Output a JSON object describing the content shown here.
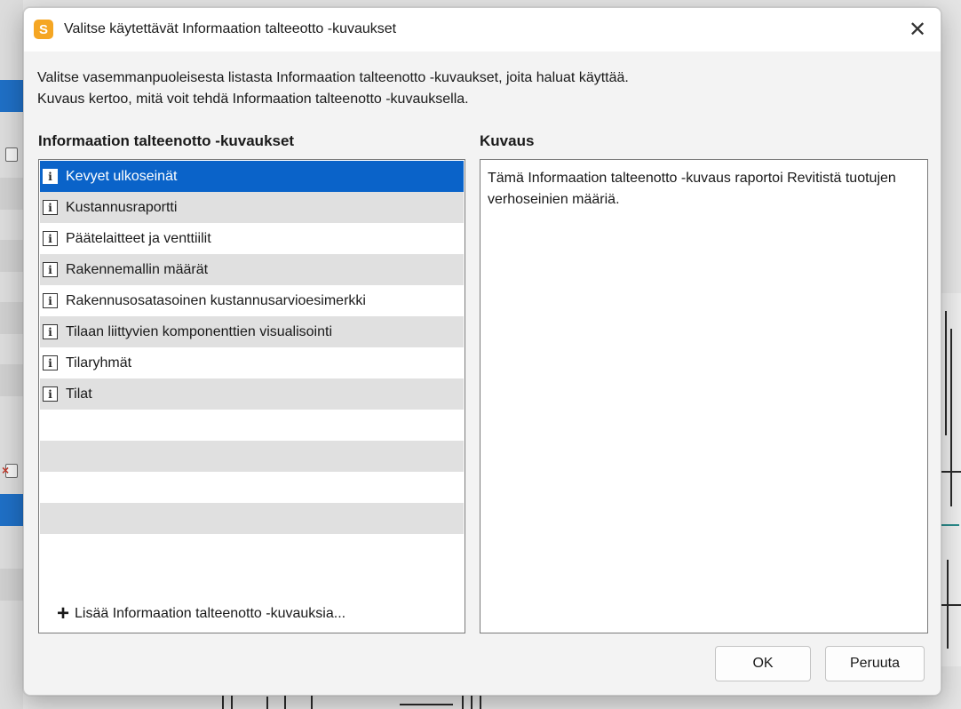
{
  "dialog": {
    "logo_letter": "S",
    "title": "Valitse käytettävät Informaation talteeotto -kuvaukset",
    "close_glyph": "✕"
  },
  "instructions": {
    "line1": "Valitse vasemmanpuoleisesta listasta Informaation talteenotto -kuvaukset, joita haluat käyttää.",
    "line2": "Kuvaus kertoo, mitä voit tehdä Informaation talteenotto -kuvauksella."
  },
  "list_pane": {
    "title": "Informaation talteenotto -kuvaukset",
    "icon_glyph": "i",
    "items": [
      {
        "label": "Kevyet ulkoseinät",
        "selected": true
      },
      {
        "label": "Kustannusraportti",
        "selected": false
      },
      {
        "label": "Päätelaitteet ja venttiilit",
        "selected": false
      },
      {
        "label": "Rakennemallin määrät",
        "selected": false
      },
      {
        "label": "Rakennusosatasoinen kustannusarvioesimerkki",
        "selected": false
      },
      {
        "label": "Tilaan liittyvien komponenttien visualisointi",
        "selected": false
      },
      {
        "label": "Tilaryhmät",
        "selected": false
      },
      {
        "label": "Tilat",
        "selected": false
      }
    ],
    "add_glyph": "+",
    "add_label": "Lisää Informaation talteenotto -kuvauksia..."
  },
  "desc_pane": {
    "title": "Kuvaus",
    "text": "Tämä Informaation talteenotto -kuvaus raportoi Revitistä tuotujen verhoseinien määriä."
  },
  "buttons": {
    "ok": "OK",
    "cancel": "Peruuta"
  },
  "colors": {
    "selection": "#0a63c9",
    "logo": "#f5a623",
    "alt_row": "#e0e0e0"
  }
}
